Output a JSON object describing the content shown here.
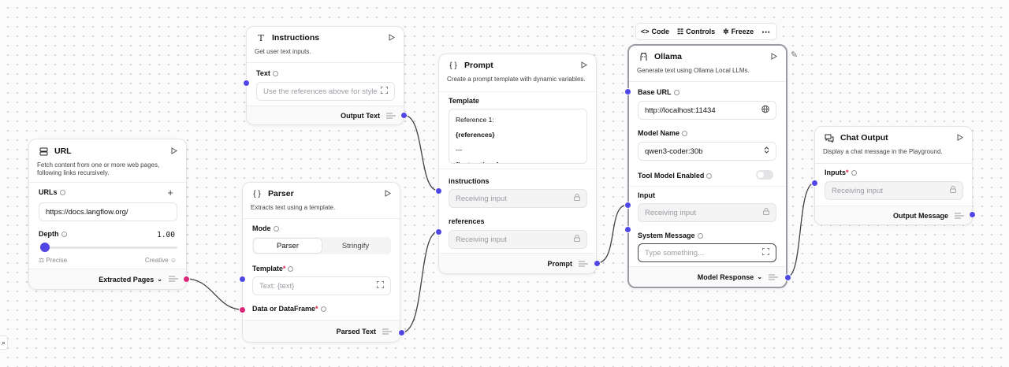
{
  "toolbar": {
    "code": "Code",
    "controls": "Controls",
    "freeze": "Freeze"
  },
  "url_node": {
    "title": "URL",
    "description": "Fetch content from one or more web pages, following links recursively.",
    "urls_label": "URLs",
    "url_value": "https://docs.langflow.org/",
    "depth_label": "Depth",
    "depth_value": "1.00",
    "depth_level": 0.0,
    "precise_label": "Precise",
    "creative_label": "Creative",
    "output": "Extracted Pages"
  },
  "instructions_node": {
    "title": "Instructions",
    "description": "Get user text inputs.",
    "text_label": "Text",
    "text_placeholder": "Use the references above for style",
    "output": "Output Text"
  },
  "parser_node": {
    "title": "Parser",
    "description": "Extracts text using a template.",
    "mode_label": "Mode",
    "mode_options": [
      "Parser",
      "Stringify"
    ],
    "template_label": "Template",
    "template_placeholder": "Text: {text}",
    "data_label": "Data or DataFrame",
    "output": "Parsed Text"
  },
  "prompt_node": {
    "title": "Prompt",
    "description": "Create a prompt template with dynamic variables.",
    "template_label": "Template",
    "template_lines": [
      "Reference 1:",
      "{references}",
      "---",
      "{instructions}"
    ],
    "instructions_label": "instructions",
    "references_label": "references",
    "receiving": "Receiving input",
    "output": "Prompt"
  },
  "ollama_node": {
    "title": "Ollama",
    "description": "Generate text using Ollama Local LLMs.",
    "base_url_label": "Base URL",
    "base_url_value": "http://localhost:11434",
    "model_label": "Model Name",
    "model_value": "qwen3-coder:30b",
    "tool_label": "Tool Model Enabled",
    "input_label": "Input",
    "input_value": "Receiving input",
    "system_label": "System Message",
    "system_placeholder": "Type something...",
    "output": "Model Response"
  },
  "chat_node": {
    "title": "Chat Output",
    "description": "Display a chat message in the Playground.",
    "inputs_label": "Inputs",
    "inputs_value": "Receiving input",
    "output": "Output Message"
  },
  "colors": {
    "handle": "#4f46e5",
    "handle_data": "#db2777",
    "required": "#e11d48"
  }
}
